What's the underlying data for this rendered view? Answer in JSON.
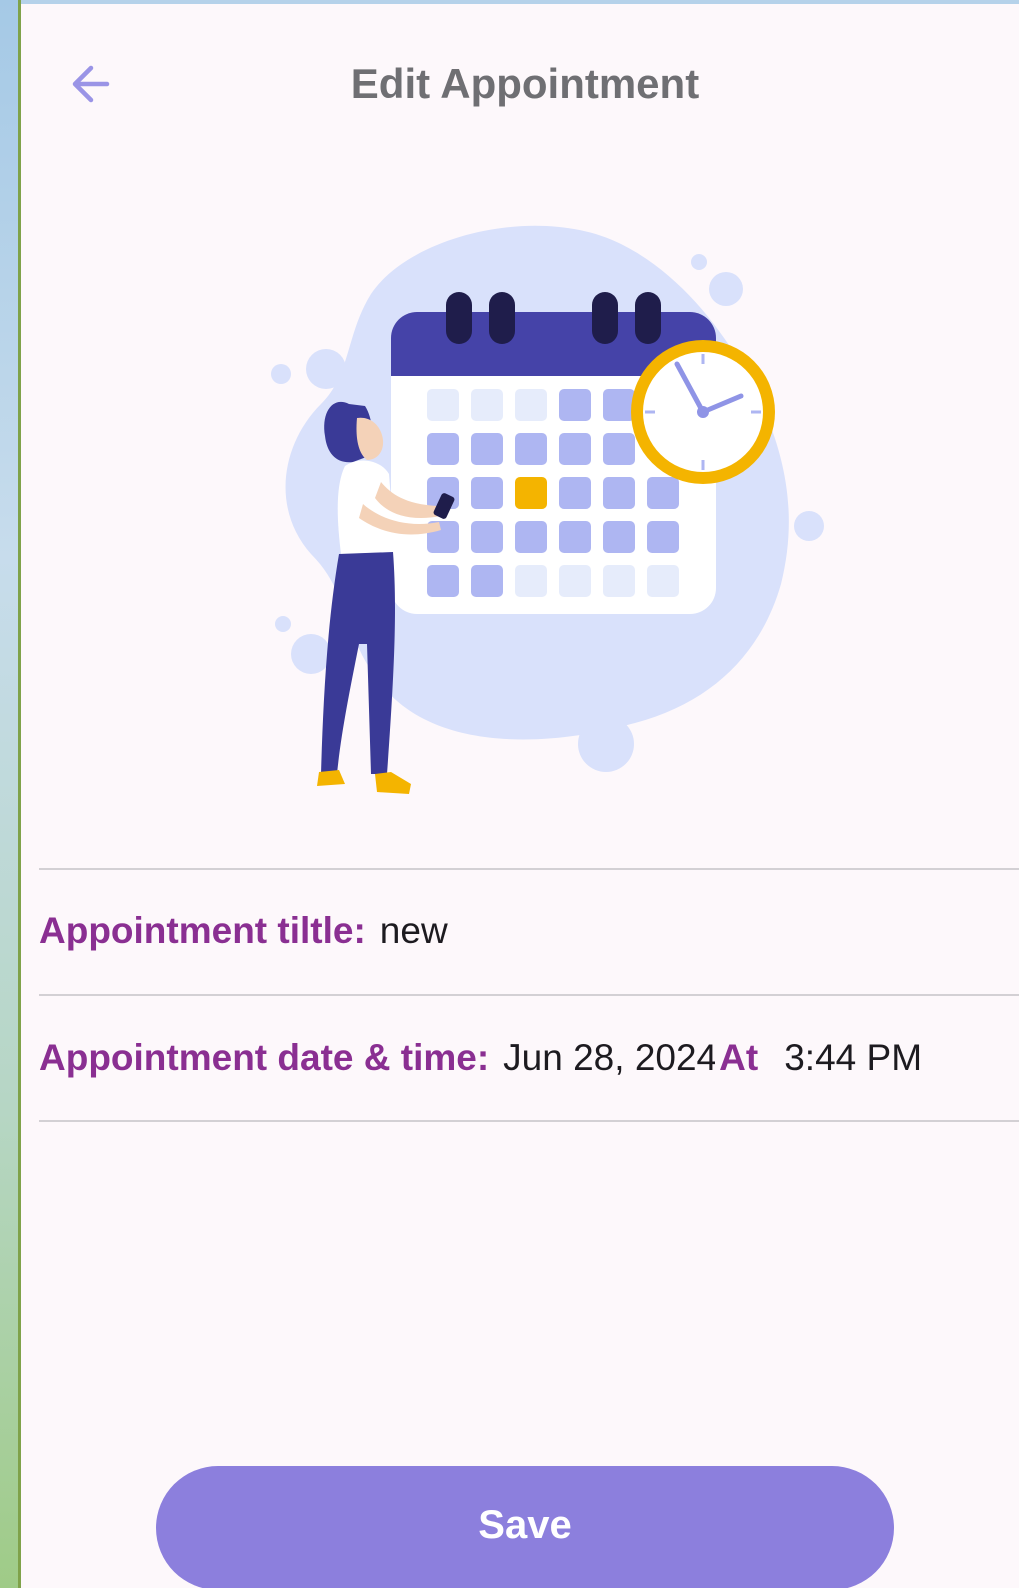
{
  "header": {
    "title": "Edit Appointment",
    "back_icon": "arrow-left-icon"
  },
  "form": {
    "title_label": "Appointment tiltle:",
    "title_value": "new",
    "datetime_label": "Appointment date & time:",
    "date_value": "Jun 28, 2024",
    "at_label": "At",
    "time_value": "3:44 PM"
  },
  "actions": {
    "save_label": "Save"
  },
  "colors": {
    "accent": "#8c7fdd",
    "label": "#8a2f92",
    "title": "#6f6f73",
    "illustration_primary": "#3f3b9e",
    "illustration_highlight": "#f4b400"
  }
}
